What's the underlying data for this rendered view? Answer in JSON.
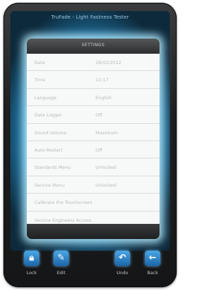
{
  "app": {
    "title": "TruFade - Light Fastness Tester"
  },
  "settings": {
    "heading": "SETTINGS",
    "rows": [
      {
        "label": "Date",
        "value": "28/02/2012"
      },
      {
        "label": "Time",
        "value": "13:17"
      },
      {
        "label": "Language",
        "value": "English"
      },
      {
        "label": "Data Logger",
        "value": "Off"
      },
      {
        "label": "Sound Volume",
        "value": "Maximum"
      },
      {
        "label": "Auto-Restart",
        "value": "Off"
      },
      {
        "label": "Standards Menu",
        "value": "Unlocked"
      },
      {
        "label": "Service Menu",
        "value": "Unlocked"
      },
      {
        "label": "Calibrate the Touchscreen",
        "value": ""
      },
      {
        "label": "Service Engineers Access",
        "value": ""
      }
    ]
  },
  "toolbar": {
    "lock": {
      "label": "Lock",
      "icon": "lock-icon"
    },
    "edit": {
      "label": "Edit",
      "icon": "pencil-icon"
    },
    "undo": {
      "label": "Undo",
      "icon": "undo-arrow-icon"
    },
    "back": {
      "label": "Back",
      "icon": "back-arrow-icon"
    }
  },
  "colors": {
    "accent": "#2a86cf",
    "glow": "#7fd0ff"
  }
}
